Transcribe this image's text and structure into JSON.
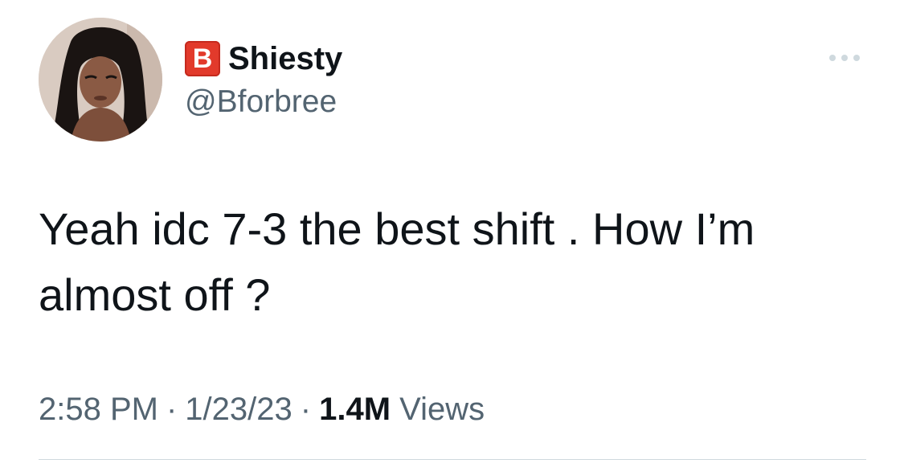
{
  "author": {
    "badge_letter": "B",
    "display_name": "Shiesty",
    "handle": "@Bforbree"
  },
  "tweet": {
    "text": "Yeah idc 7-3 the best shift . How I’m almost off ?"
  },
  "meta": {
    "time": "2:58 PM",
    "separator": "·",
    "date": "1/23/23",
    "views_count": "1.4M",
    "views_label": "Views"
  },
  "colors": {
    "badge": "#e23a2b",
    "secondary_text": "#536471",
    "primary_text": "#0f1419",
    "divider": "#cfd9de"
  },
  "icons": {
    "more": "more-horizontal-icon",
    "avatar": "profile-photo"
  }
}
